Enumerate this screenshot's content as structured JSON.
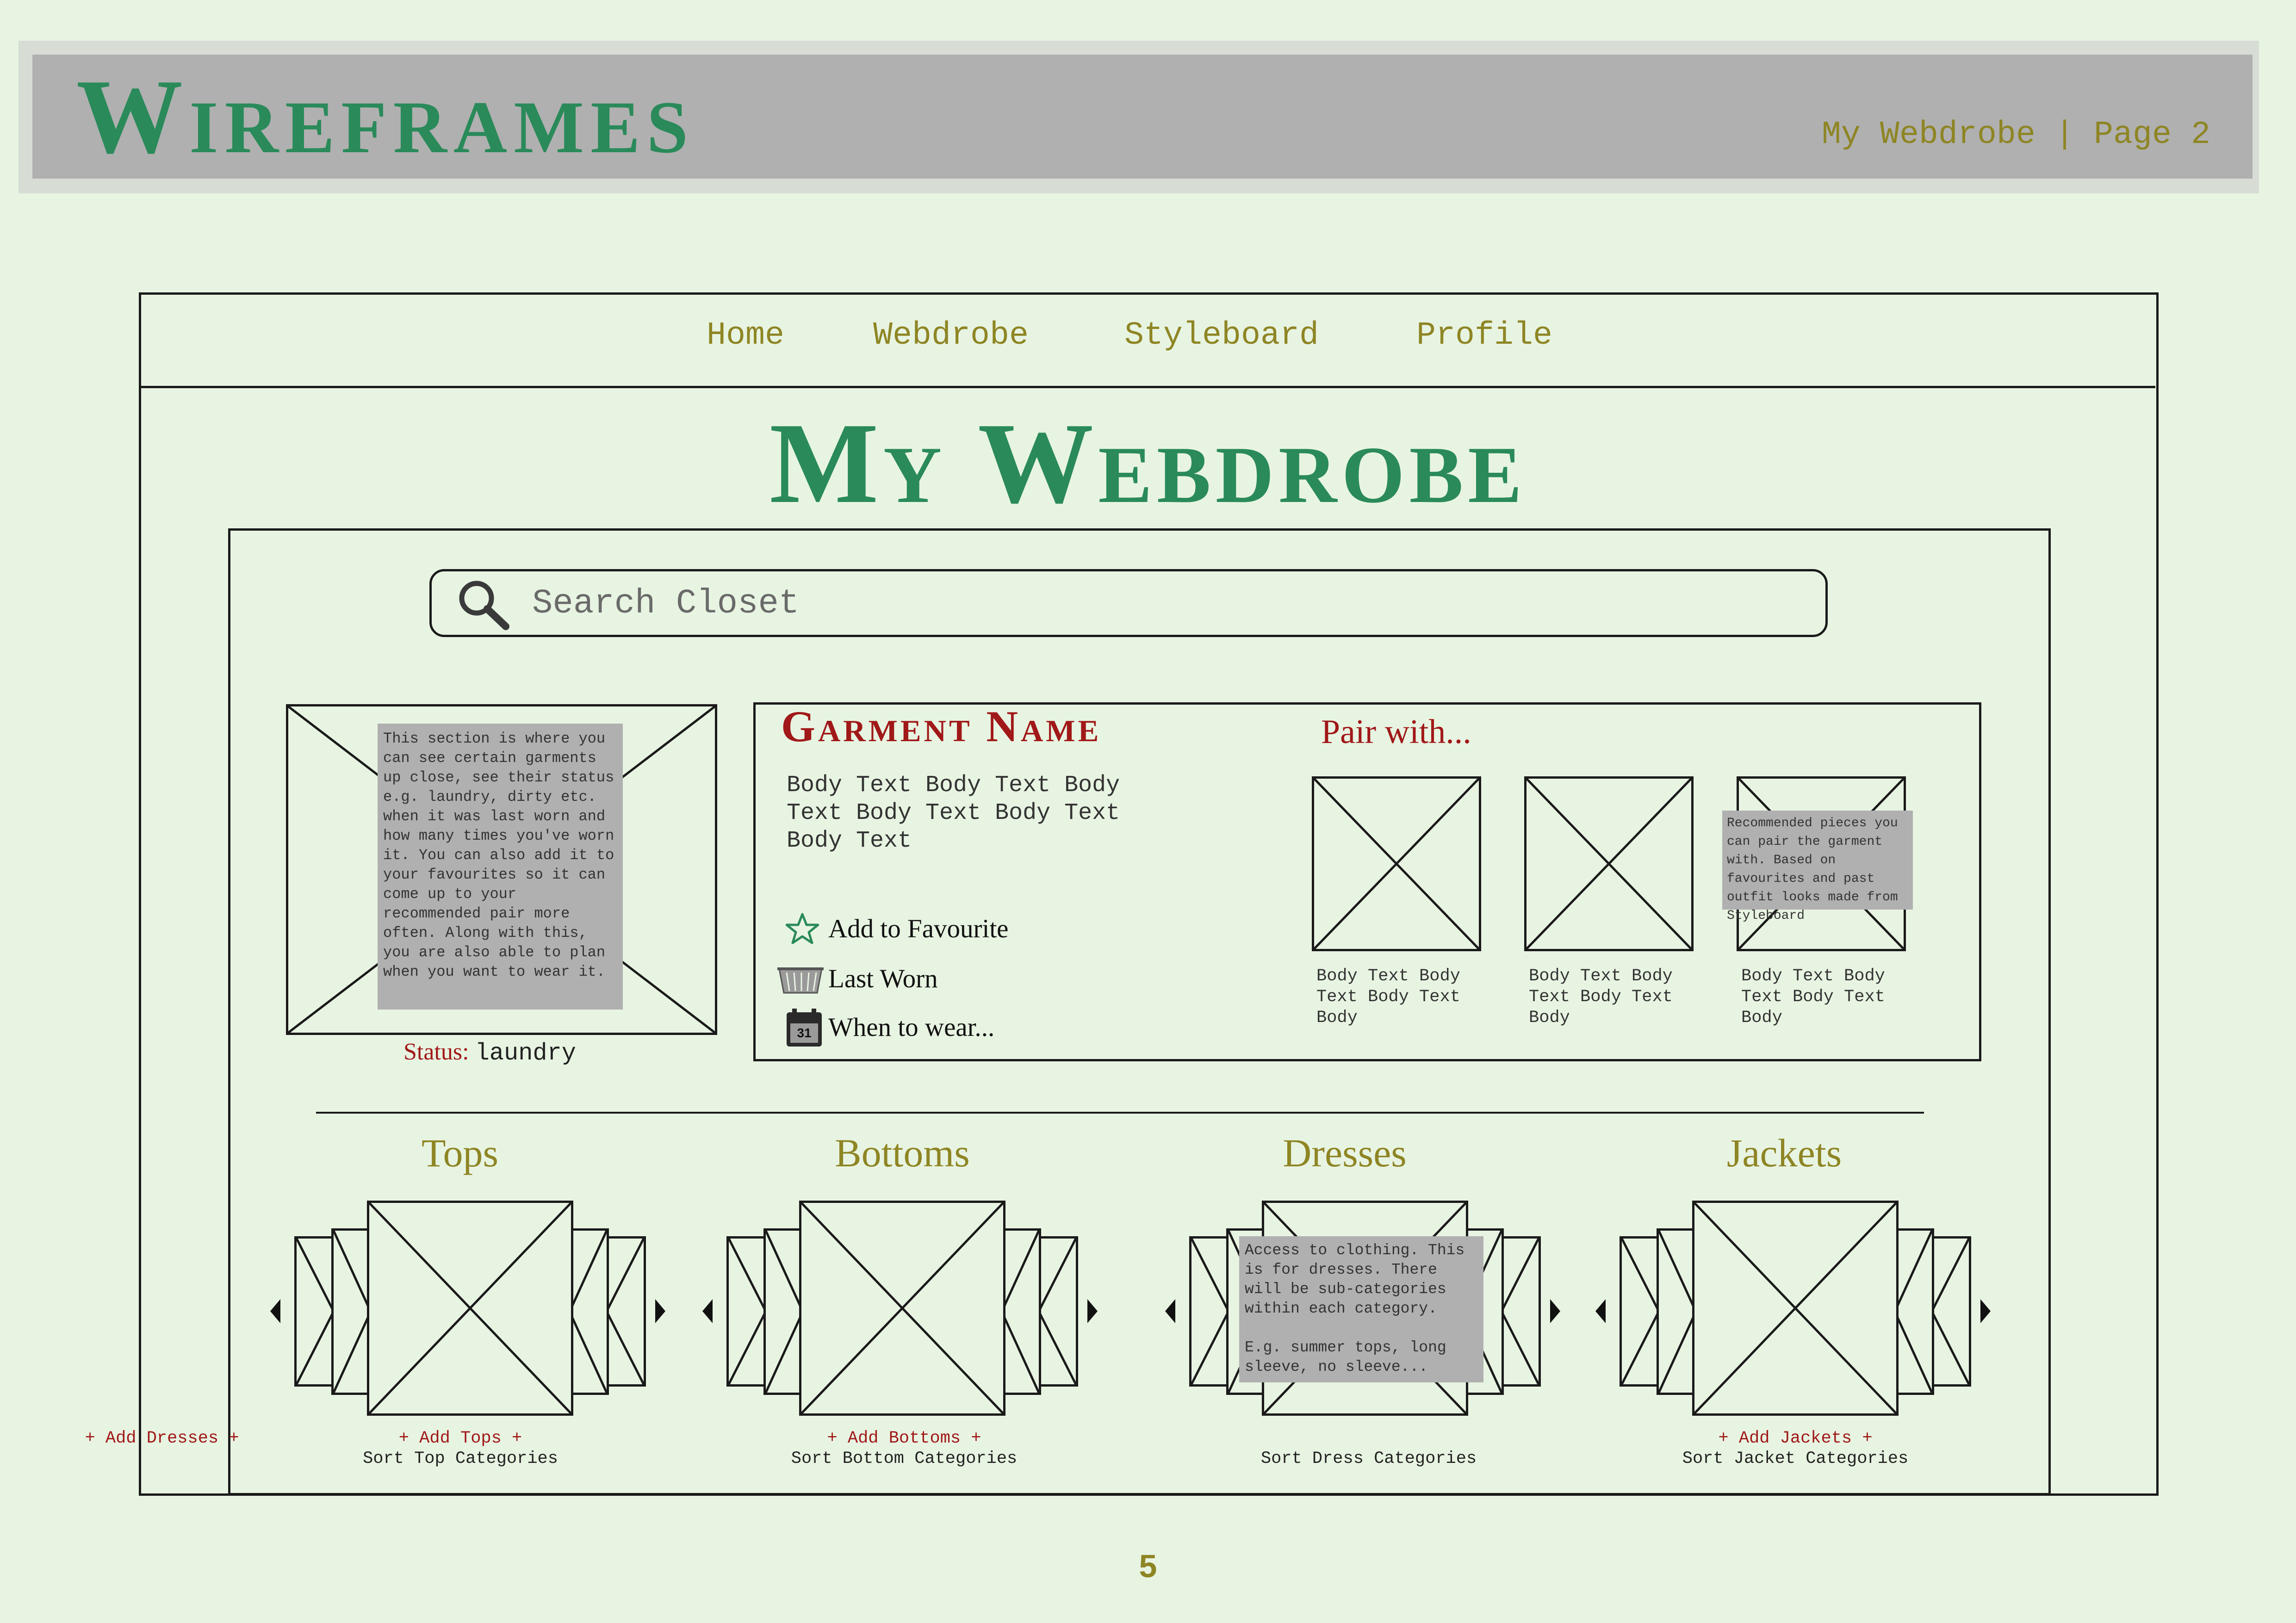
{
  "header": {
    "title": "Wireframes",
    "subtitle": "My Webdrobe | Page 2"
  },
  "nav": {
    "items": [
      "Home",
      "Webdrobe",
      "Styleboard",
      "Profile"
    ]
  },
  "page_title": "My Webdrobe",
  "search": {
    "placeholder": "Search Closet",
    "icon": "search-icon"
  },
  "garment_note": "This section is where you can see certain garments up close, see their status e.g. laundry, dirty etc. when it was last worn and how many times you've worn it. You can also add it to your favourites so it can come up to your recommended pair more often. Along with this, you are also able to plan when you want to wear it.",
  "status": {
    "label": "Status:",
    "value": "laundry"
  },
  "garment": {
    "name": "Garment Name",
    "body": "Body Text Body Text Body Text Body Text Body Text Body Text",
    "actions": [
      {
        "label": "Add to Favourite",
        "icon": "star-icon"
      },
      {
        "label": "Last Worn",
        "icon": "laundry-basket-icon"
      },
      {
        "label": "When to wear...",
        "icon": "calendar-icon",
        "icon_text": "31"
      }
    ]
  },
  "pair_with": {
    "title": "Pair with...",
    "captions": [
      "Body Text Body Text Body Text Body",
      "Body Text Body Text Body Text Body",
      "Body Text Body Text Body Text Body"
    ],
    "note": "Recommended pieces you can pair the garment with. Based on favourites and past outfit looks made from Styleboard"
  },
  "categories": [
    {
      "title": "Tops",
      "add": "+ Add Tops +",
      "sort": "Sort Top Categories"
    },
    {
      "title": "Bottoms",
      "add": "+ Add Bottoms +",
      "sort": "Sort Bottom Categories"
    },
    {
      "title": "Dresses",
      "add": "+ Add Dresses +",
      "sort": "Sort Dress Categories"
    },
    {
      "title": "Jackets",
      "add": "+ Add Jackets +",
      "sort": "Sort Jacket Categories"
    }
  ],
  "category_note": "Access to clothing. This is for dresses. There will be sub-categories within each category.\n\nE.g. summer tops, long sleeve, no sleeve...",
  "page_number": "5",
  "colors": {
    "background": "#e8f4e2",
    "header_band": "#b0b0b0",
    "title_green": "#2a8a5a",
    "olive": "#8e8524",
    "accent_red": "#a01818",
    "note_gray": "#b0b0b0"
  }
}
